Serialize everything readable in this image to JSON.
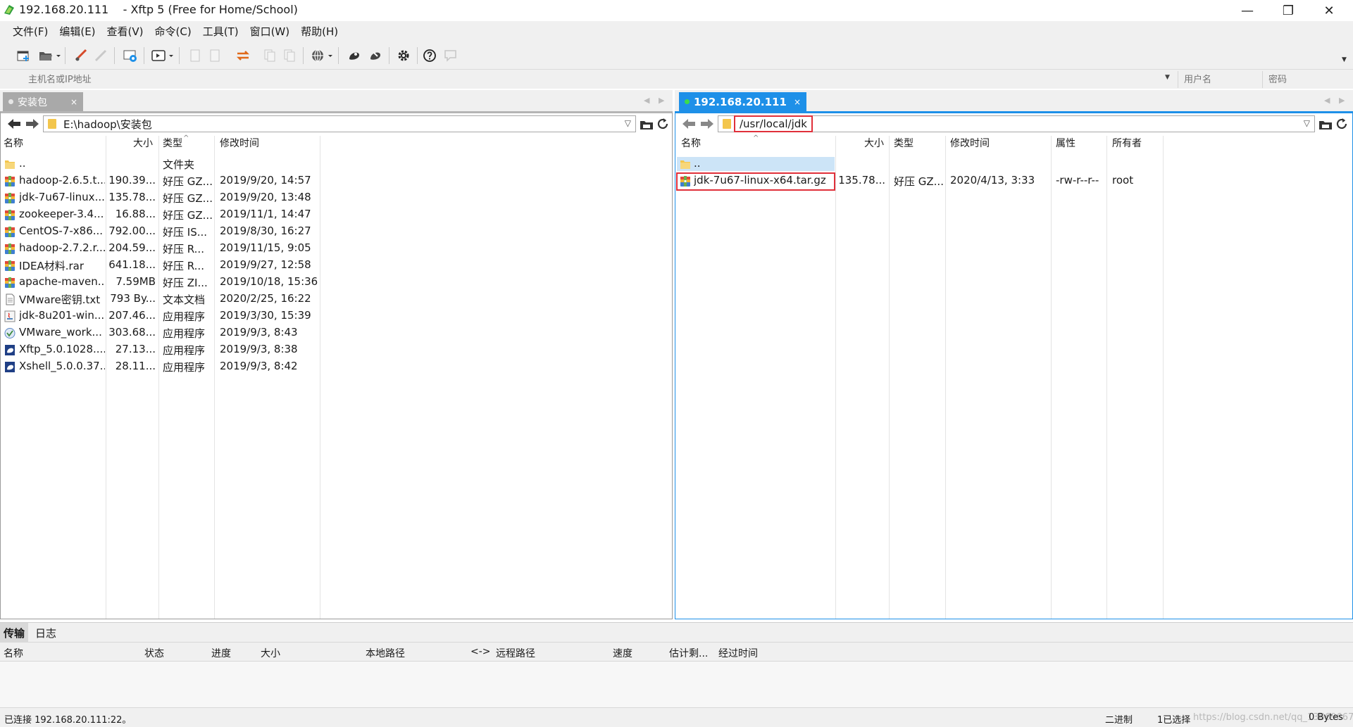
{
  "window": {
    "title": "192.168.20.111    - Xftp 5 (Free for Home/School)",
    "minimize_glyph": "—",
    "restore_glyph": "❐",
    "close_glyph": "✕"
  },
  "menu": [
    "文件(F)",
    "编辑(E)",
    "查看(V)",
    "命令(C)",
    "工具(T)",
    "窗口(W)",
    "帮助(H)"
  ],
  "addressbar": {
    "host_placeholder": "主机名或IP地址",
    "user_placeholder": "用户名",
    "pass_placeholder": "密码"
  },
  "local": {
    "tab_label": "安装包",
    "tab_close": "×",
    "path": "E:\\hadoop\\安装包",
    "columns": [
      "名称",
      "大小",
      "类型",
      "修改时间"
    ],
    "files": [
      {
        "name": "..",
        "size": "",
        "type": "文件夹",
        "modified": "",
        "icon": "folder-icon"
      },
      {
        "name": "hadoop-2.6.5.t...",
        "size": "190.39...",
        "type": "好压 GZ...",
        "modified": "2019/9/20, 14:57",
        "icon": "archive-icon"
      },
      {
        "name": "jdk-7u67-linux...",
        "size": "135.78...",
        "type": "好压 GZ...",
        "modified": "2019/9/20, 13:48",
        "icon": "archive-icon"
      },
      {
        "name": "zookeeper-3.4....",
        "size": "16.88...",
        "type": "好压 GZ...",
        "modified": "2019/11/1, 14:47",
        "icon": "archive-icon"
      },
      {
        "name": "CentOS-7-x86...",
        "size": "792.00...",
        "type": "好压 IS...",
        "modified": "2019/8/30, 16:27",
        "icon": "archive-icon"
      },
      {
        "name": "hadoop-2.7.2.r...",
        "size": "204.59...",
        "type": "好压 R...",
        "modified": "2019/11/15, 9:05",
        "icon": "archive-icon"
      },
      {
        "name": "IDEA材料.rar",
        "size": "641.18...",
        "type": "好压 R...",
        "modified": "2019/9/27, 12:58",
        "icon": "archive-icon"
      },
      {
        "name": "apache-maven...",
        "size": "7.59MB",
        "type": "好压 ZI...",
        "modified": "2019/10/18, 15:36",
        "icon": "archive-icon"
      },
      {
        "name": "VMware密钥.txt",
        "size": "793 By...",
        "type": "文本文档",
        "modified": "2020/2/25, 16:22",
        "icon": "text-file-icon"
      },
      {
        "name": "jdk-8u201-win...",
        "size": "207.46...",
        "type": "应用程序",
        "modified": "2019/3/30, 15:39",
        "icon": "java-installer-icon"
      },
      {
        "name": "VMware_work...",
        "size": "303.68...",
        "type": "应用程序",
        "modified": "2019/9/3, 8:43",
        "icon": "vmware-installer-icon"
      },
      {
        "name": "Xftp_5.0.1028....",
        "size": "27.13...",
        "type": "应用程序",
        "modified": "2019/9/3, 8:38",
        "icon": "xftp-installer-icon"
      },
      {
        "name": "Xshell_5.0.0.37...",
        "size": "28.11...",
        "type": "应用程序",
        "modified": "2019/9/3, 8:42",
        "icon": "xshell-installer-icon"
      }
    ]
  },
  "remote": {
    "tab_label": "192.168.20.111",
    "tab_close": "×",
    "path": "/usr/local/jdk",
    "columns": [
      "名称",
      "大小",
      "类型",
      "修改时间",
      "属性",
      "所有者"
    ],
    "files": [
      {
        "name": "..",
        "size": "",
        "type": "",
        "modified": "",
        "attr": "",
        "owner": "",
        "icon": "folder-icon"
      },
      {
        "name": "jdk-7u67-linux-x64.tar.gz",
        "size": "135.78...",
        "type": "好压 GZ...",
        "modified": "2020/4/13, 3:33",
        "attr": "-rw-r--r--",
        "owner": "root",
        "icon": "archive-icon"
      }
    ]
  },
  "transfer": {
    "tabs": [
      "传输",
      "日志"
    ],
    "columns": [
      "名称",
      "状态",
      "进度",
      "大小",
      "本地路径",
      "<->",
      "远程路径",
      "速度",
      "估计剩...",
      "经过时间"
    ]
  },
  "status": {
    "connection": "已连接 192.168.20.111:22。",
    "mode": "二进制",
    "selection": "1已选择",
    "bytes": "0 Bytes",
    "watermark": "https://blog.csdn.net/qq_13869667"
  },
  "colors": {
    "remote_accent": "#1e90e8",
    "highlight_box": "#e0303a",
    "local_tab_bg": "#a9a9a9"
  }
}
